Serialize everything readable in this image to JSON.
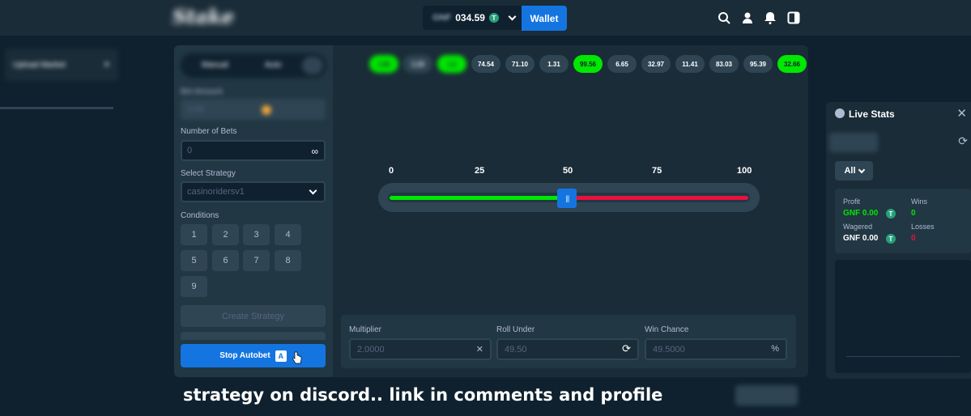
{
  "topbar": {
    "logo": "Stake",
    "balance_currency": "GNF",
    "balance": "034.59",
    "coin_symbol": "T",
    "wallet_label": "Wallet"
  },
  "sidenav": {
    "item_label": "Upload Market"
  },
  "control": {
    "tab_manual": "Manual",
    "tab_auto": "Auto",
    "bet_amount_label": "Bet Amount",
    "bet_amount_value": "0.00",
    "bets_label": "Number of Bets",
    "bets_value": "0",
    "bets_icon": "infinity-icon",
    "strategy_label": "Select Strategy",
    "strategy_value": "casinoridersv1",
    "conditions_label": "Conditions",
    "conditions": [
      "1",
      "2",
      "3",
      "4",
      "5",
      "6",
      "7",
      "8",
      "9"
    ],
    "create_label": "Create Strategy",
    "stop_label": "Stop Autobet"
  },
  "results": [
    {
      "value": "1.82",
      "win": true,
      "fuzzy": true
    },
    {
      "value": "1.10",
      "win": false,
      "fuzzy": true
    },
    {
      "value": "1.2",
      "win": true,
      "fuzzy": true
    },
    {
      "value": "74.54",
      "win": false,
      "fuzzy": false
    },
    {
      "value": "71.10",
      "win": false,
      "fuzzy": false
    },
    {
      "value": "1.31",
      "win": false,
      "fuzzy": false
    },
    {
      "value": "99.56",
      "win": true,
      "fuzzy": false
    },
    {
      "value": "6.65",
      "win": false,
      "fuzzy": false
    },
    {
      "value": "32.97",
      "win": false,
      "fuzzy": false
    },
    {
      "value": "11.41",
      "win": false,
      "fuzzy": false
    },
    {
      "value": "83.03",
      "win": false,
      "fuzzy": false
    },
    {
      "value": "95.39",
      "win": false,
      "fuzzy": false
    },
    {
      "value": "32.66",
      "win": true,
      "fuzzy": false
    }
  ],
  "slider": {
    "scale": [
      "0",
      "25",
      "50",
      "75",
      "100"
    ],
    "roll_under_value": 49.5
  },
  "bottom": {
    "multiplier_label": "Multiplier",
    "multiplier_value": "2.0000",
    "roll_label": "Roll Under",
    "roll_value": "49.50",
    "chance_label": "Win Chance",
    "chance_value": "49.5000",
    "chance_suffix": "%"
  },
  "stats": {
    "title": "Live Stats",
    "filter": "All",
    "profit_label": "Profit",
    "profit_value": "GNF 0.00",
    "wins_label": "Wins",
    "wins_value": "0",
    "wagered_label": "Wagered",
    "wagered_value": "GNF 0.00",
    "losses_label": "Losses",
    "losses_value": "0"
  },
  "caption": "strategy on discord.. link in comments and profile",
  "colors": {
    "bg": "#0f212e",
    "panel": "#1a2c38",
    "accent": "#1475e1",
    "win": "#00e701",
    "loss": "#e9113c"
  }
}
